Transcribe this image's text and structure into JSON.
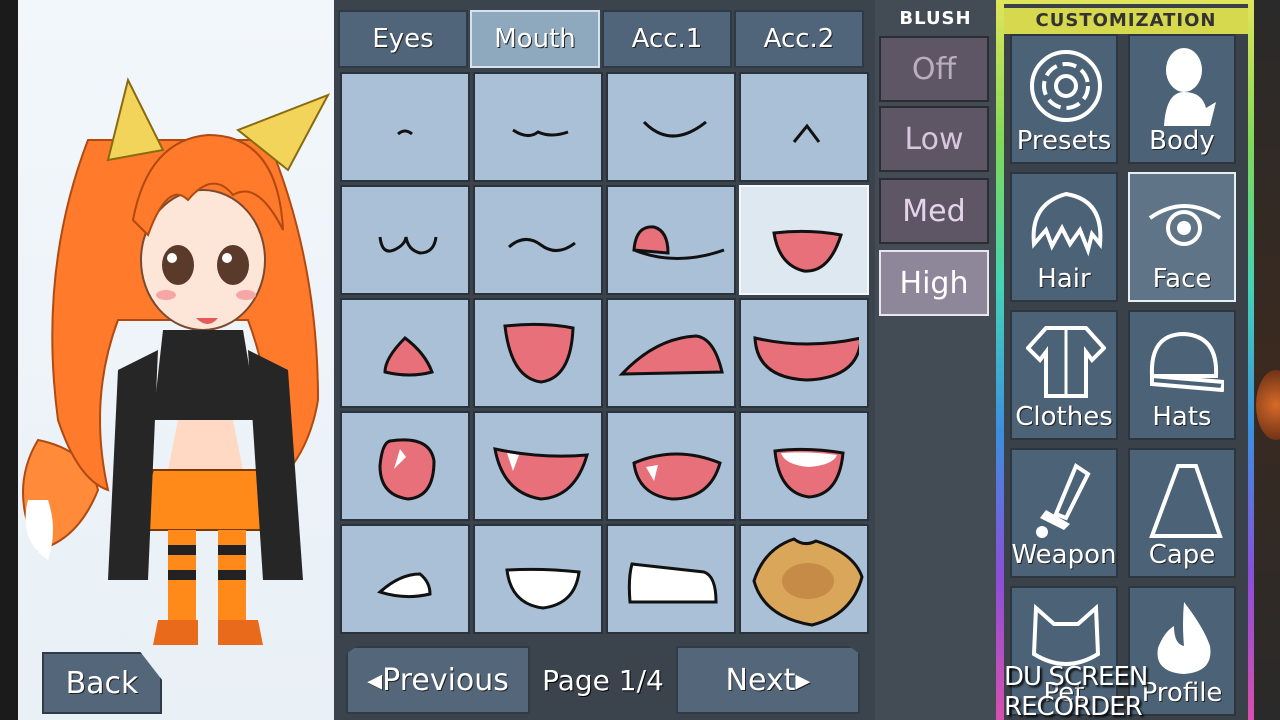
{
  "tabs": [
    {
      "label": "Eyes",
      "active": false
    },
    {
      "label": "Mouth",
      "active": true
    },
    {
      "label": "Acc.1",
      "active": false
    },
    {
      "label": "Acc.2",
      "active": false
    }
  ],
  "grid": {
    "selected_index": 7,
    "items": [
      "mouth-small-dot",
      "mouth-smile-line",
      "mouth-smile-curve",
      "mouth-caret",
      "mouth-cat-w",
      "mouth-wavy",
      "mouth-tongue-out",
      "mouth-open-oval",
      "mouth-small-triangle",
      "mouth-open-round",
      "mouth-wide-open",
      "mouth-big-open",
      "mouth-fang-round",
      "mouth-fang-smile",
      "mouth-fang-grin",
      "mouth-teeth-open",
      "mouth-teeth-small",
      "mouth-teeth-smile",
      "mouth-teeth-grit",
      "mouth-toast"
    ]
  },
  "pager": {
    "previous_label": "Previous",
    "page_label": "Page 1/4",
    "next_label": "Next"
  },
  "back_label": "Back",
  "blush": {
    "title": "BLUSH",
    "options": [
      "Off",
      "Low",
      "Med",
      "High"
    ],
    "active": "High"
  },
  "customization": {
    "title": "CUSTOMIZATION",
    "items": [
      {
        "label": "Presets",
        "icon": "presets-icon"
      },
      {
        "label": "Body",
        "icon": "body-icon"
      },
      {
        "label": "Hair",
        "icon": "hair-icon"
      },
      {
        "label": "Face",
        "icon": "eye-icon",
        "active": true
      },
      {
        "label": "Clothes",
        "icon": "clothes-icon"
      },
      {
        "label": "Hats",
        "icon": "cap-icon"
      },
      {
        "label": "Weapon",
        "icon": "sword-icon"
      },
      {
        "label": "Cape",
        "icon": "cape-icon"
      },
      {
        "label": "Pet",
        "icon": "cat-icon"
      },
      {
        "label": "Profile",
        "icon": "flame-icon"
      }
    ]
  },
  "watermark": "DU SCREEN RECORDER",
  "colors": {
    "accent": "#8ea8bd",
    "panel": "#3b434c",
    "cell": "#a9c0d6",
    "blush_active": "#8e8699"
  }
}
